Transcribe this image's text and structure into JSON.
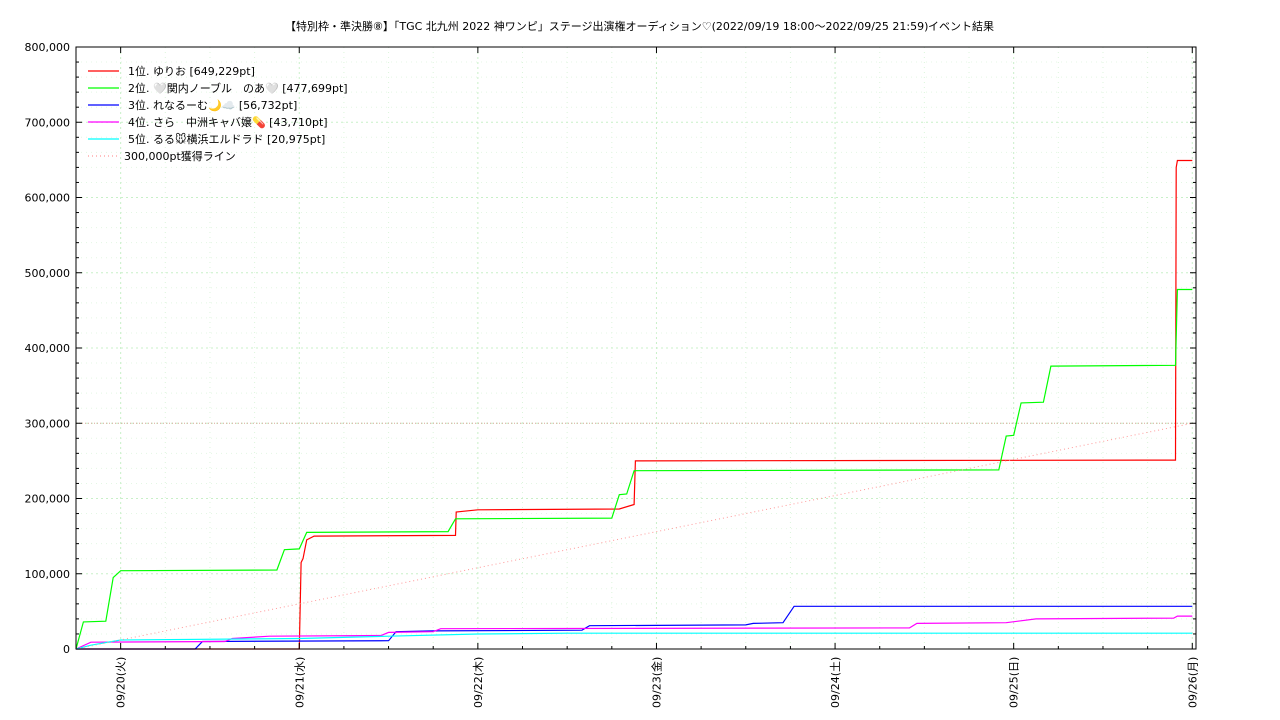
{
  "chart_data": {
    "type": "line",
    "title": "【特別枠・準決勝⑧】「TGC 北九州 2022 神ワンピ」ステージ出演権オーディション♡(2022/09/19 18:00〜2022/09/25 21:59)",
    "subtitle": "イベント結果",
    "xlabel": "",
    "ylabel": "",
    "x_ticks": [
      "09/20(火)",
      "09/21(水)",
      "09/22(木)",
      "09/23(金)",
      "09/24(土)",
      "09/25(日)",
      "09/26(月)"
    ],
    "xlim": [
      "2022/09/19 18:00",
      "2022/09/26 00:30"
    ],
    "ylim": [
      0,
      800000
    ],
    "y_ticks": [
      "0",
      "100,000",
      "200,000",
      "300,000",
      "400,000",
      "500,000",
      "600,000",
      "700,000",
      "800,000"
    ],
    "grid": true,
    "legend_position": "top-left",
    "series": [
      {
        "name": "1位. ゆりお [649,229pt]",
        "color": "#ff0000",
        "points": [
          [
            "2022/09/19 18:00",
            0
          ],
          [
            "2022/09/21 00:00",
            0
          ],
          [
            "2022/09/21 00:15",
            115000
          ],
          [
            "2022/09/21 00:30",
            120000
          ],
          [
            "2022/09/21 01:00",
            145000
          ],
          [
            "2022/09/21 02:00",
            150000
          ],
          [
            "2022/09/21 21:00",
            151000
          ],
          [
            "2022/09/21 21:05",
            182000
          ],
          [
            "2022/09/21 22:00",
            183000
          ],
          [
            "2022/09/22 00:00",
            185000
          ],
          [
            "2022/09/22 19:00",
            186000
          ],
          [
            "2022/09/22 21:00",
            192000
          ],
          [
            "2022/09/22 21:10",
            250000
          ],
          [
            "2022/09/25 21:45",
            251000
          ],
          [
            "2022/09/25 21:50",
            640000
          ],
          [
            "2022/09/25 22:00",
            649229
          ],
          [
            "2022/09/26 00:00",
            649229
          ]
        ]
      },
      {
        "name": "2位. 🤍関内ノーブル　のあ🤍 [477,699pt]",
        "color": "#00ff00",
        "points": [
          [
            "2022/09/19 18:00",
            0
          ],
          [
            "2022/09/19 19:00",
            36000
          ],
          [
            "2022/09/19 22:00",
            37000
          ],
          [
            "2022/09/19 23:00",
            95000
          ],
          [
            "2022/09/20 00:00",
            104000
          ],
          [
            "2022/09/20 21:00",
            105000
          ],
          [
            "2022/09/20 22:00",
            132000
          ],
          [
            "2022/09/21 00:00",
            133000
          ],
          [
            "2022/09/21 01:00",
            155000
          ],
          [
            "2022/09/21 20:00",
            156000
          ],
          [
            "2022/09/21 21:00",
            173000
          ],
          [
            "2022/09/22 18:00",
            174000
          ],
          [
            "2022/09/22 19:00",
            205000
          ],
          [
            "2022/09/22 20:00",
            206000
          ],
          [
            "2022/09/22 21:00",
            237000
          ],
          [
            "2022/09/24 22:00",
            238000
          ],
          [
            "2022/09/24 23:00",
            283000
          ],
          [
            "2022/09/25 00:00",
            284000
          ],
          [
            "2022/09/25 01:00",
            327000
          ],
          [
            "2022/09/25 04:00",
            328000
          ],
          [
            "2022/09/25 05:00",
            376000
          ],
          [
            "2022/09/25 21:45",
            377000
          ],
          [
            "2022/09/25 22:00",
            477699
          ],
          [
            "2022/09/26 00:00",
            477699
          ]
        ]
      },
      {
        "name": "3位. れなるーむ🌙☁️ [56,732pt]",
        "color": "#0000ff",
        "points": [
          [
            "2022/09/19 18:00",
            0
          ],
          [
            "2022/09/20 10:00",
            0
          ],
          [
            "2022/09/20 11:00",
            10000
          ],
          [
            "2022/09/21 12:00",
            11000
          ],
          [
            "2022/09/21 13:00",
            23000
          ],
          [
            "2022/09/21 18:00",
            24000
          ],
          [
            "2022/09/22 14:00",
            25000
          ],
          [
            "2022/09/22 15:00",
            31000
          ],
          [
            "2022/09/23 12:00",
            32000
          ],
          [
            "2022/09/23 13:00",
            34000
          ],
          [
            "2022/09/23 17:00",
            35000
          ],
          [
            "2022/09/23 18:30",
            56732
          ],
          [
            "2022/09/26 00:00",
            56732
          ]
        ]
      },
      {
        "name": "4位. さら　中洲キャバ嬢💊 [43,710pt]",
        "color": "#ff00ff",
        "points": [
          [
            "2022/09/19 18:00",
            0
          ],
          [
            "2022/09/19 20:00",
            9000
          ],
          [
            "2022/09/20 14:00",
            10000
          ],
          [
            "2022/09/20 15:00",
            14000
          ],
          [
            "2022/09/20 20:00",
            17000
          ],
          [
            "2022/09/21 11:00",
            18000
          ],
          [
            "2022/09/21 12:00",
            22000
          ],
          [
            "2022/09/21 18:00",
            23000
          ],
          [
            "2022/09/21 19:00",
            27000
          ],
          [
            "2022/09/24 10:00",
            28000
          ],
          [
            "2022/09/24 11:00",
            34000
          ],
          [
            "2022/09/24 23:00",
            35000
          ],
          [
            "2022/09/25 03:00",
            40000
          ],
          [
            "2022/09/25 21:30",
            41000
          ],
          [
            "2022/09/25 22:00",
            43710
          ],
          [
            "2022/09/26 00:00",
            43710
          ]
        ]
      },
      {
        "name": "5位. るる🐭横浜エルドラド [20,975pt]",
        "color": "#00ffff",
        "points": [
          [
            "2022/09/19 18:00",
            0
          ],
          [
            "2022/09/19 20:00",
            5000
          ],
          [
            "2022/09/20 00:00",
            12000
          ],
          [
            "2022/09/21 00:00",
            14000
          ],
          [
            "2022/09/21 12:00",
            17000
          ],
          [
            "2022/09/22 00:00",
            20000
          ],
          [
            "2022/09/22 12:00",
            20975
          ],
          [
            "2022/09/26 00:00",
            20975
          ]
        ]
      },
      {
        "name": "300,000pt獲得ライン",
        "color": "#ff9999",
        "dashed": true,
        "points": [
          [
            "2022/09/19 18:00",
            0
          ],
          [
            "2022/09/26 00:00",
            300000
          ]
        ]
      }
    ],
    "reference_lines": [
      {
        "y": 300000,
        "color": "#d9a89a"
      }
    ]
  }
}
